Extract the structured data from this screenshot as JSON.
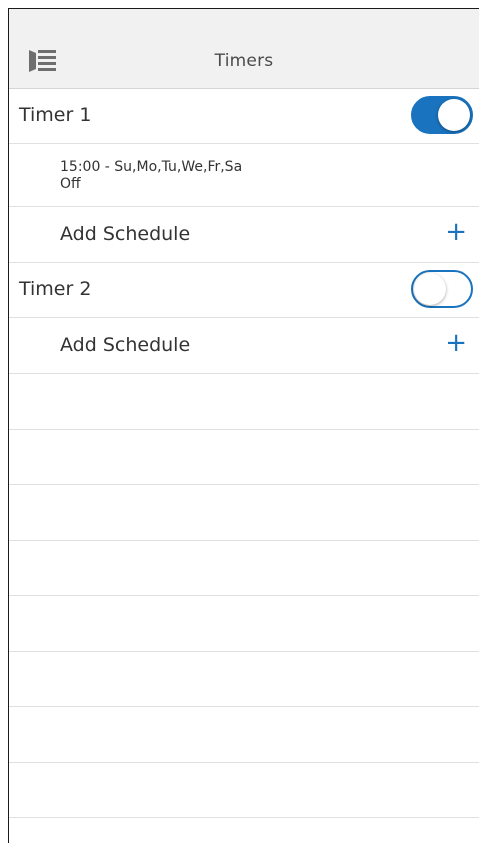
{
  "header": {
    "title": "Timers",
    "menu_icon": "sidebar-menu-icon"
  },
  "colors": {
    "accent": "#1a73be",
    "header_bg": "#f1f1f2",
    "divider": "#e0e0e2",
    "text": "#333333"
  },
  "timers": [
    {
      "label": "Timer 1",
      "enabled": true,
      "schedules": [
        {
          "time": "15:00 - Su,Mo,Tu,We,Fr,Sa",
          "action": "Off"
        }
      ],
      "add_label": "Add Schedule",
      "add_icon": "plus-icon"
    },
    {
      "label": "Timer 2",
      "enabled": false,
      "schedules": [],
      "add_label": "Add Schedule",
      "add_icon": "plus-icon"
    }
  ]
}
